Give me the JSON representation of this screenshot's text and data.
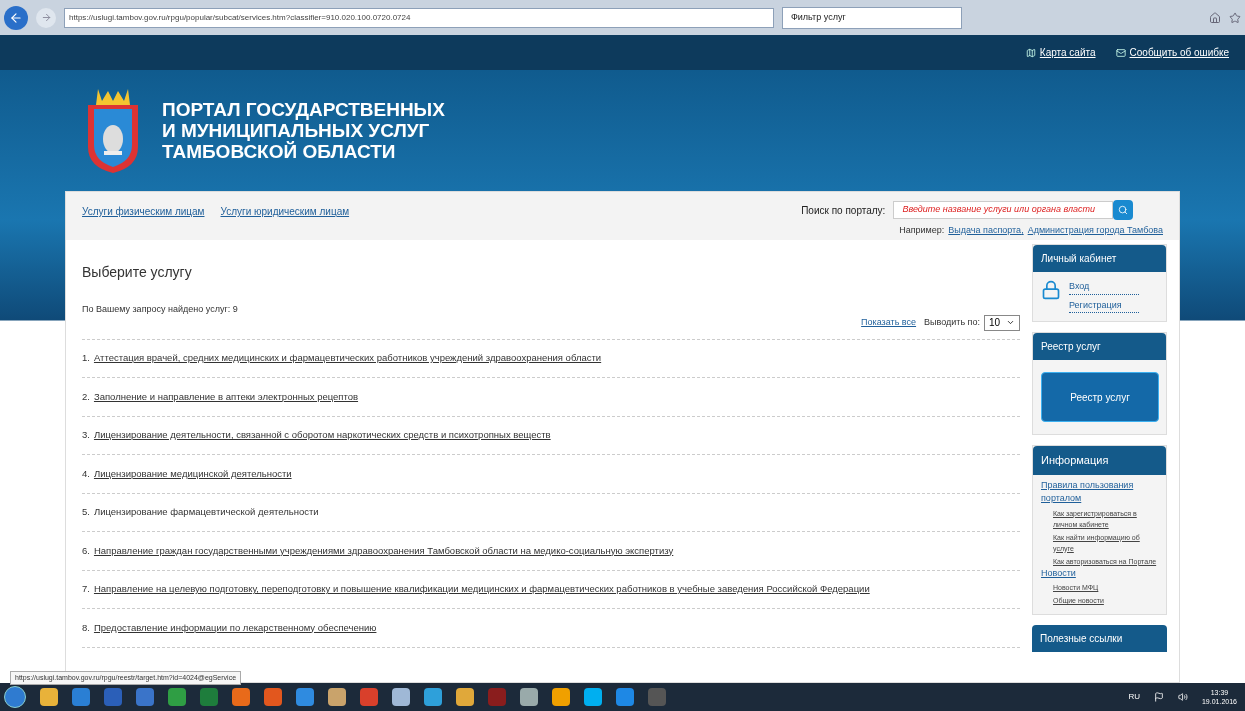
{
  "browser": {
    "url": "https://uslugi.tambov.gov.ru/rpgu/popular/subcat/services.htm?classifier=910.020.100.0720.0724",
    "tab": "Фильтр услуг"
  },
  "top_links": [
    "Карта сайта",
    "Сообщить об ошибке"
  ],
  "header": {
    "title_lines": [
      "ПОРТАЛ ГОСУДАРСТВЕННЫХ",
      "И МУНИЦИПАЛЬНЫХ УСЛУГ",
      "ТАМБОВСКОЙ ОБЛАСТИ"
    ]
  },
  "nav": [
    "Услуги физическим лицам",
    "Услуги юридическим лицам"
  ],
  "search": {
    "label": "Поиск по порталу:",
    "placeholder": "Введите название услуги или органа власти",
    "example_label": "Например:",
    "examples": [
      "Выдача паспорта",
      "Администрация города Тамбова"
    ],
    "separator": ","
  },
  "main": {
    "heading": "Выберите услугу",
    "found": "По Вашему запросу найдено услуг: 9",
    "show_all": "Показать все",
    "per_page_label": "Выводить по:",
    "per_page": "10",
    "services": [
      {
        "number": "1.",
        "title": "Аттестация врачей, средних медицинских и фармацевтических работников учреждений здравоохранения области",
        "linked": true
      },
      {
        "number": "2.",
        "title": "Заполнение и направление в аптеки электронных рецептов",
        "linked": true
      },
      {
        "number": "3.",
        "title": "Лицензирование деятельности, связанной с оборотом наркотических средств и психотропных веществ",
        "linked": true
      },
      {
        "number": "4.",
        "title": "Лицензирование медицинской деятельности",
        "linked": true
      },
      {
        "number": "5.",
        "title": "Лицензирование фармацевтической деятельности",
        "linked": false
      },
      {
        "number": "6.",
        "title": "Направление граждан государственными учреждениями здравоохранения Тамбовской области на медико-социальную экспертизу",
        "linked": true
      },
      {
        "number": "7.",
        "title": "Направление на целевую подготовку, переподготовку и повышение квалификации медицинских и фармацевтических работников в учебные заведения Российской Федерации",
        "linked": true
      },
      {
        "number": "8.",
        "title": "Предоставление информации по лекарственному обеспечению",
        "linked": true
      }
    ]
  },
  "sidebar": {
    "cabinet": {
      "title": "Личный кабинет",
      "links": [
        "Вход",
        "Регистрация"
      ]
    },
    "registry": {
      "title": "Реестр услуг",
      "button": "Реестр услуг"
    },
    "info": {
      "title": "Информация",
      "items": [
        {
          "label": "Правила пользования порталом",
          "children": [
            {
              "label": "Как зарегистрироваться в личном кабинете"
            },
            {
              "label": "Как найти информацию об услуге"
            },
            {
              "label": "Как авторизоваться на Портале"
            }
          ]
        },
        {
          "label": "Новости",
          "children": [
            {
              "label": "Новости МФЦ"
            },
            {
              "label": "Общие новости"
            }
          ]
        }
      ]
    },
    "useful": {
      "title": "Полезные ссылки"
    }
  },
  "status_tooltip": "https://uslugi.tambov.gov.ru/rpgu/reestr/target.htm?id=4024@egService",
  "taskbar": {
    "language": "RU",
    "time": "13:39",
    "date": "19.01.2016"
  }
}
